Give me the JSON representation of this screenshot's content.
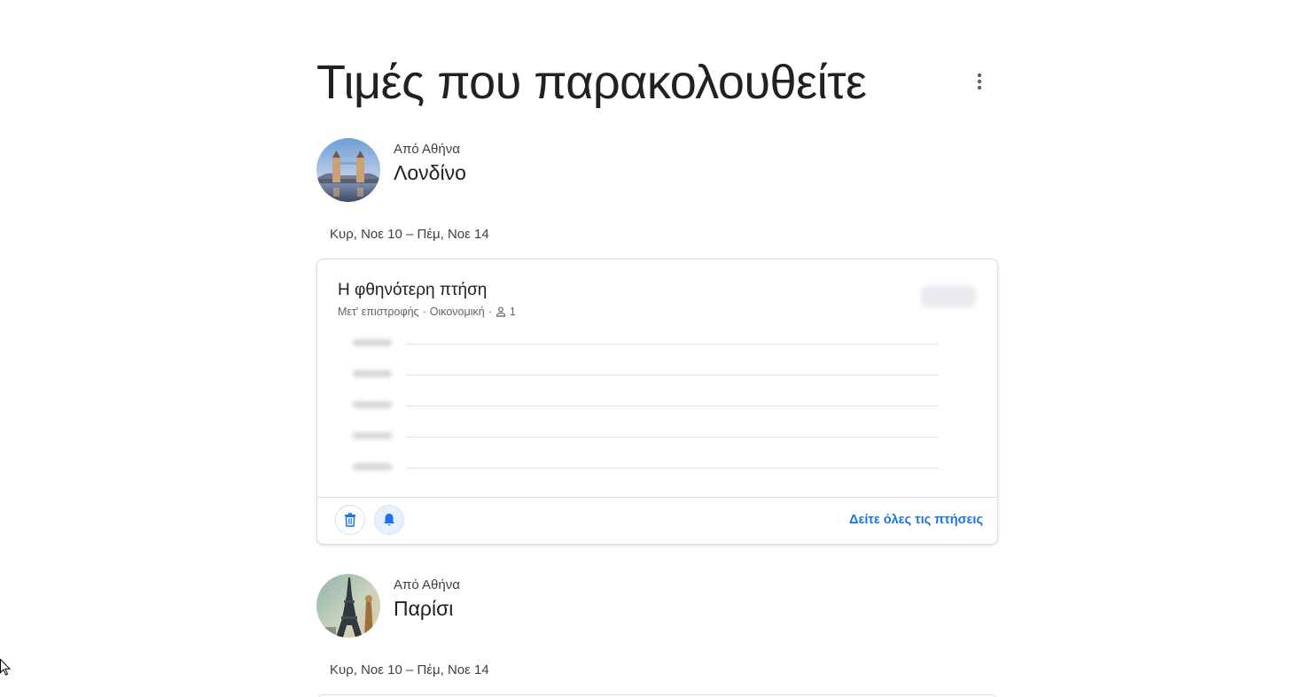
{
  "page": {
    "title": "Τιμές που παρακολουθείτε"
  },
  "destinations": [
    {
      "from": "Από Αθήνα",
      "name": "Λονδίνο",
      "dates": "Κυρ, Νοε 10 – Πέμ, Νοε 14",
      "avatar": "tower-bridge-photo",
      "card": {
        "title": "Η φθηνότερη πτήση",
        "trip_type": "Μετ' επιστροφής",
        "cabin": "Οικονομική",
        "passengers": "1",
        "see_all_label": "Δείτε όλες τις πτήσεις"
      }
    },
    {
      "from": "Από Αθήνα",
      "name": "Παρίσι",
      "dates": "Κυρ, Νοε 10 – Πέμ, Νοε 14",
      "avatar": "eiffel-tower-photo"
    }
  ],
  "colors": {
    "accent": "#1a73e8",
    "text": "#202124",
    "secondary_text": "#5f6368",
    "divider": "#dadce0"
  },
  "icons": {
    "more": "more-vert-icon",
    "person": "person-icon",
    "delete": "trash-icon",
    "alert": "bell-icon"
  }
}
